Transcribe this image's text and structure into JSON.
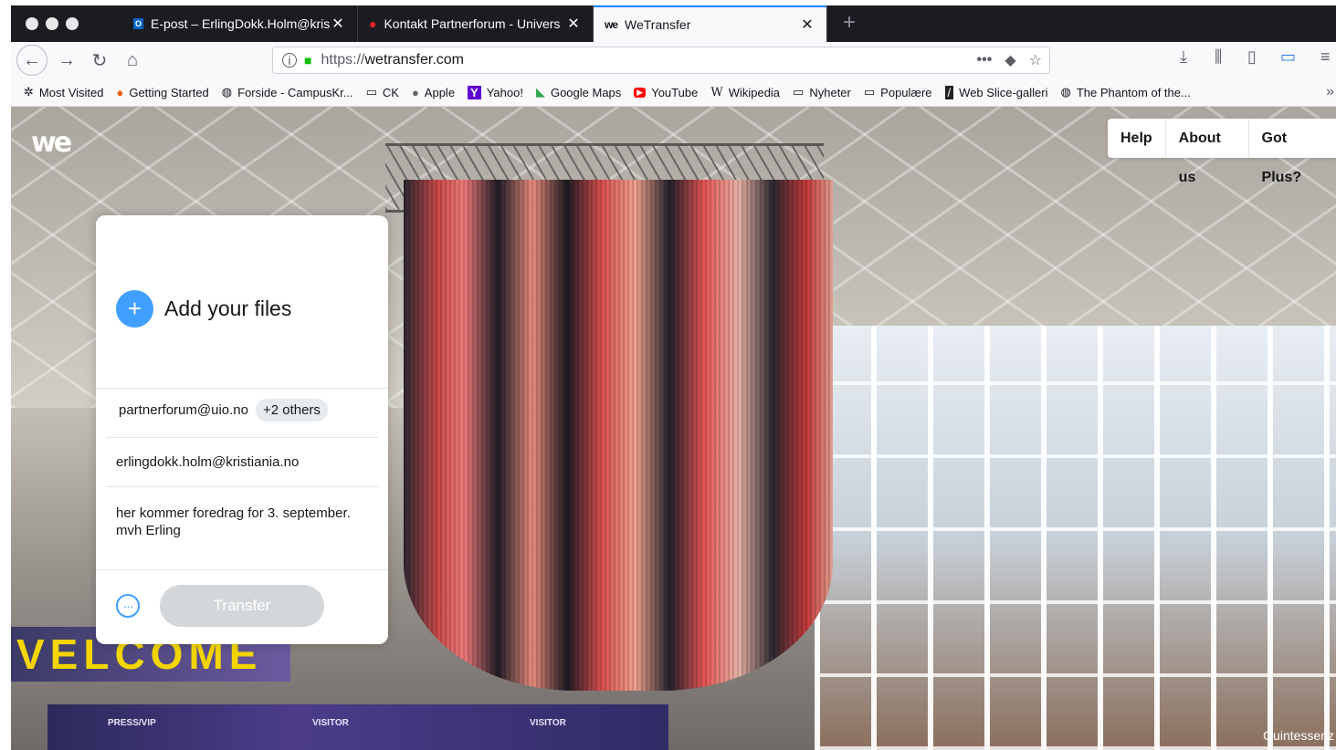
{
  "browser": {
    "tabs": [
      {
        "label": "E-post – ErlingDokk.Holm@kris",
        "icon": "outlook-icon"
      },
      {
        "label": "Kontakt Partnerforum - Univers",
        "icon": "pin-icon"
      },
      {
        "label": "WeTransfer",
        "icon": "wetransfer-icon",
        "active": true
      }
    ],
    "url": {
      "protocol": "https://",
      "host": "wetransfer.com"
    },
    "page_actions": "•••",
    "bookmarks": [
      {
        "label": "Most Visited",
        "icon": "gear-icon"
      },
      {
        "label": "Getting Started",
        "icon": "firefox-icon"
      },
      {
        "label": "Forside - CampusKr...",
        "icon": "globe-icon"
      },
      {
        "label": "CK",
        "icon": "folder-icon"
      },
      {
        "label": "Apple",
        "icon": "apple-icon"
      },
      {
        "label": "Yahoo!",
        "icon": "yahoo-icon"
      },
      {
        "label": "Google Maps",
        "icon": "maps-icon"
      },
      {
        "label": "YouTube",
        "icon": "youtube-icon"
      },
      {
        "label": "Wikipedia",
        "icon": "wikipedia-icon"
      },
      {
        "label": "Nyheter",
        "icon": "folder-icon"
      },
      {
        "label": "Populære",
        "icon": "folder-icon"
      },
      {
        "label": "Web Slice-galleri",
        "icon": "webslice-icon"
      },
      {
        "label": "The Phantom of the...",
        "icon": "globe-icon"
      }
    ]
  },
  "site": {
    "logo": "we",
    "nav": [
      "Help",
      "About us",
      "Got Plus?"
    ]
  },
  "upload": {
    "add_files_label": "Add your files",
    "recipient": "partnerforum@uio.no",
    "recipient_more": "+2 others",
    "sender": "erlingdokk.holm@kristiania.no",
    "message": "her kommer foredrag for 3. september. mvh Erling",
    "transfer_label": "Transfer"
  },
  "background": {
    "banner_text": "VELCOME",
    "booth_labels": [
      "PRESS/VIP",
      "VISITOR",
      "VISITOR"
    ],
    "credit": "Quintessenz"
  },
  "colors": {
    "accent": "#409fff",
    "button_disabled": "#d4d7d9",
    "tab_active_line": "#0a84ff"
  }
}
